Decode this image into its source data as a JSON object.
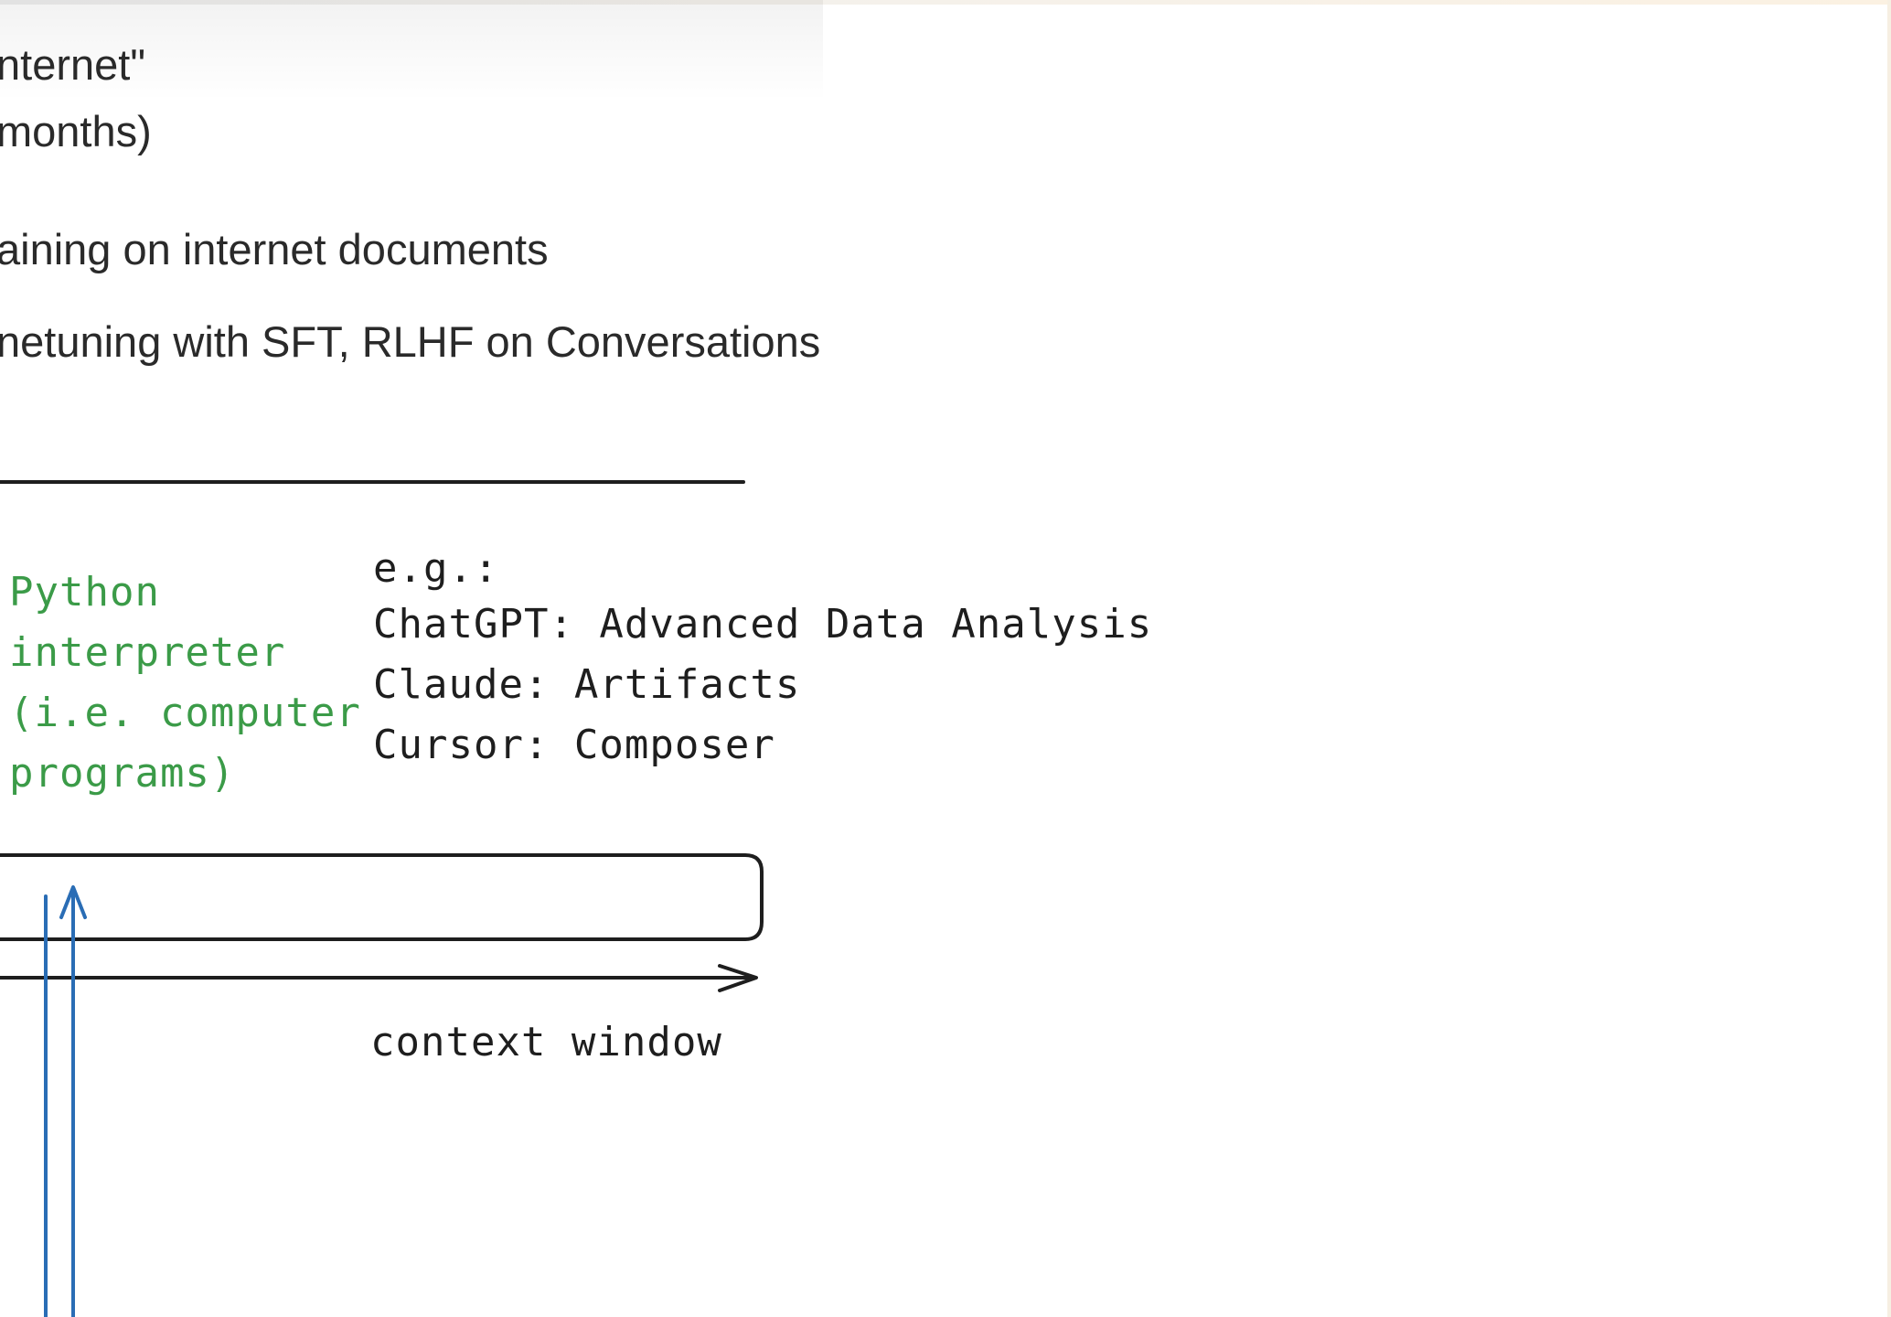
{
  "slide_text": {
    "lines": [
      "nternet\"",
      "months)",
      "aining on internet documents",
      "netuning with SFT, RLHF on Conversations"
    ]
  },
  "diagram": {
    "tool_label_lines": [
      "Python",
      "interpreter",
      "(i.e. computer",
      "programs)"
    ],
    "examples_lines": [
      "e.g.:",
      "ChatGPT: Advanced Data Analysis",
      "Claude: Artifacts",
      "Cursor: Composer"
    ],
    "axis_label": "context window"
  },
  "colors": {
    "text": "#2a2a2a",
    "drawing": "#1e1e1e",
    "green_label": "#3b9b48",
    "blue_arrows": "#2a6db5"
  }
}
